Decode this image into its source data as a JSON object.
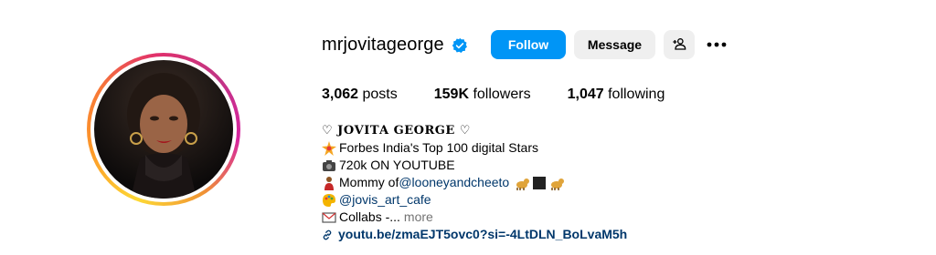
{
  "profile": {
    "username": "mrjovitageorge",
    "verified_icon": "verified-badge-icon",
    "follow_label": "Follow",
    "message_label": "Message",
    "add_user_icon": "add-user-icon",
    "more_icon": "more-options-icon",
    "brand_color": "#0095f6"
  },
  "stats": {
    "posts_count": "3,062",
    "posts_label": "posts",
    "followers_count": "159K",
    "followers_label": "followers",
    "following_count": "1,047",
    "following_label": "following"
  },
  "bio": {
    "name_line": "♡ 𝐉𝐎𝐕𝐈𝐓𝐀 𝐆𝐄𝐎𝐑𝐆𝐄 ♡",
    "line1": "Forbes India's Top 100 digital Stars",
    "line2": "720k ON YOUTUBE",
    "line3_prefix": "Mommy of ",
    "line3_mention": "@looneyandcheeto",
    "line4_mention": "@jovis_art_cafe",
    "line5": "Collabs -...",
    "more_label": "more",
    "link_text": "youtu.be/zmaEJT5ovc0?si=-4LtDLN_BoLvaM5h"
  }
}
